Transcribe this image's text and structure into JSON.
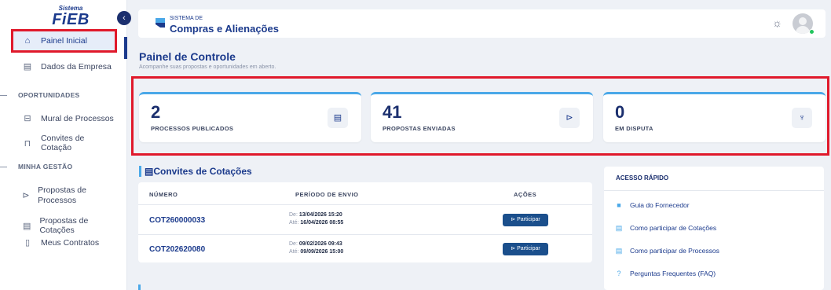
{
  "brand": {
    "small": "Sistema",
    "big": "FiEB"
  },
  "sidebar": {
    "items": [
      {
        "label": "Painel Inicial",
        "icon": "home-icon"
      },
      {
        "label": "Dados da Empresa",
        "icon": "id-card-icon"
      }
    ],
    "sections": [
      {
        "title": "OPORTUNIDADES",
        "items": [
          {
            "label": "Mural de Processos",
            "icon": "briefcase-icon"
          },
          {
            "label": "Convites de Cotação",
            "icon": "shopping-bag-icon"
          }
        ]
      },
      {
        "title": "MINHA GESTÃO",
        "items": [
          {
            "label": "Propostas de Processos",
            "icon": "send-icon"
          },
          {
            "label": "Propostas de Cotações",
            "icon": "list-icon"
          },
          {
            "label": "Meus Contratos",
            "icon": "document-icon"
          }
        ]
      }
    ]
  },
  "header": {
    "system_label": "SISTEMA DE",
    "system_name": "Compras e Alienações",
    "accent": "#1b3a8c"
  },
  "page": {
    "title": "Painel de Controle",
    "subtitle": "Acompanhe suas propostas e oportunidades em aberto."
  },
  "stats": [
    {
      "value": "2",
      "label": "PROCESSOS PUBLICADOS",
      "icon": "list-icon"
    },
    {
      "value": "41",
      "label": "PROPOSTAS ENVIADAS",
      "icon": "send-icon"
    },
    {
      "value": "0",
      "label": "EM DISPUTA",
      "icon": "trophy-icon"
    }
  ],
  "invites": {
    "title": "Convites de Cotações",
    "columns": [
      "NÚMERO",
      "PERÍODO DE ENVIO",
      "AÇÕES"
    ],
    "from_label": "De:",
    "to_label": "Até:",
    "button_label": "Participar",
    "rows": [
      {
        "code": "COT260000033",
        "from": "13/04/2026 15:20",
        "to": "16/04/2026 08:55"
      },
      {
        "code": "COT202620080",
        "from": "09/02/2026 09:43",
        "to": "09/09/2026 15:00"
      }
    ]
  },
  "quick_access": {
    "title": "ACESSO RÁPIDO",
    "items": [
      {
        "label": "Guia do Fornecedor",
        "icon": "book-icon"
      },
      {
        "label": "Como participar de Cotações",
        "icon": "list-icon"
      },
      {
        "label": "Como participar de Processos",
        "icon": "list-icon"
      },
      {
        "label": "Perguntas Frequentes (FAQ)",
        "icon": "question-icon"
      }
    ]
  }
}
